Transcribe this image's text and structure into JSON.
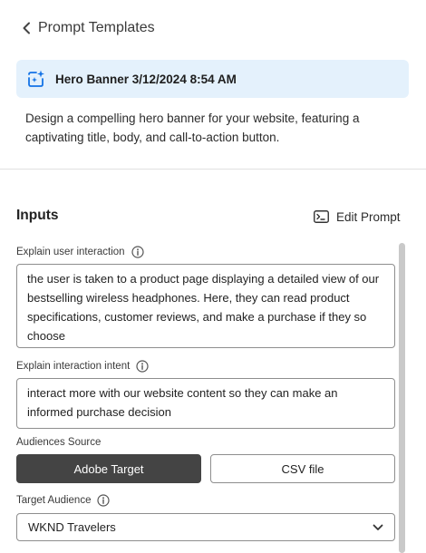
{
  "header": {
    "back_label": "Prompt Templates"
  },
  "template": {
    "title": "Hero Banner 3/12/2024 8:54 AM",
    "description": "Design a compelling hero banner for your website, featuring a captivating title, body, and call-to-action button."
  },
  "inputs": {
    "heading": "Inputs",
    "edit_prompt_label": "Edit Prompt",
    "user_interaction": {
      "label": "Explain user interaction",
      "value": "the user is taken to a product page displaying a detailed view of our bestselling wireless headphones. Here, they can read product specifications, customer reviews, and make a purchase if they so choose"
    },
    "interaction_intent": {
      "label": "Explain interaction intent",
      "value": "interact more with our website content so they can make an informed purchase decision"
    },
    "audiences_source": {
      "label": "Audiences Source",
      "options": [
        "Adobe Target",
        "CSV file"
      ],
      "selected": "Adobe Target"
    },
    "target_audience": {
      "label": "Target Audience",
      "value": "WKND Travelers"
    }
  },
  "icons": {
    "back": "chevron-left-icon",
    "template": "ai-sparkle-icon",
    "edit": "terminal-icon",
    "info": "info-icon",
    "dropdown": "chevron-down-icon"
  }
}
